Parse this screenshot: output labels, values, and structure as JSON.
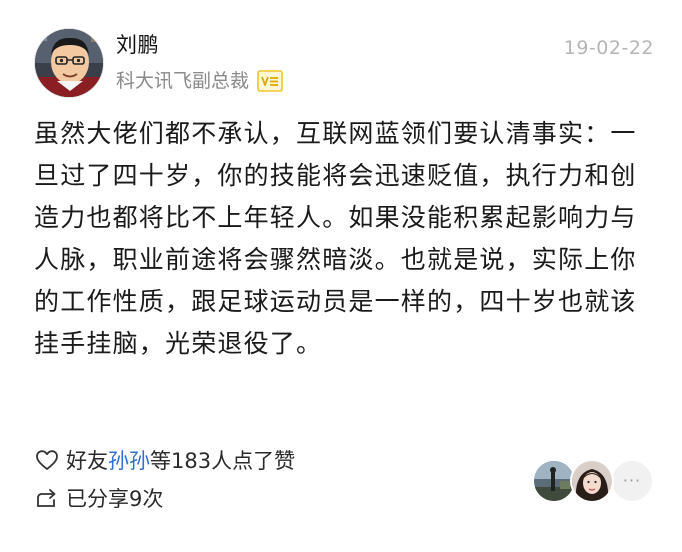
{
  "post": {
    "author_name": "刘鹏",
    "author_title": "科大讯飞副总裁",
    "date": "19-02-22",
    "content": "虽然大佬们都不承认，互联网蓝领们要认清事实：一旦过了四十岁，你的技能将会迅速贬值，执行力和创造力也都将比不上年轻人。如果没能积累起影响力与人脉，职业前途将会骤然暗淡。也就是说，实际上你的工作性质，跟足球运动员是一样的，四十岁也就该挂手挂脑，光荣退役了。"
  },
  "likes": {
    "prefix": "好友",
    "friend": "孙孙",
    "suffix": "等183人点了赞"
  },
  "shares": {
    "label": "已分享9次"
  },
  "likers": {
    "more_label": "···"
  },
  "colors": {
    "friend_link": "#2f6fd0",
    "badge": "#f1c232"
  },
  "icons": {
    "like": "heart-outline-icon",
    "share": "share-arrow-icon",
    "verified": "verified-badge-icon"
  }
}
